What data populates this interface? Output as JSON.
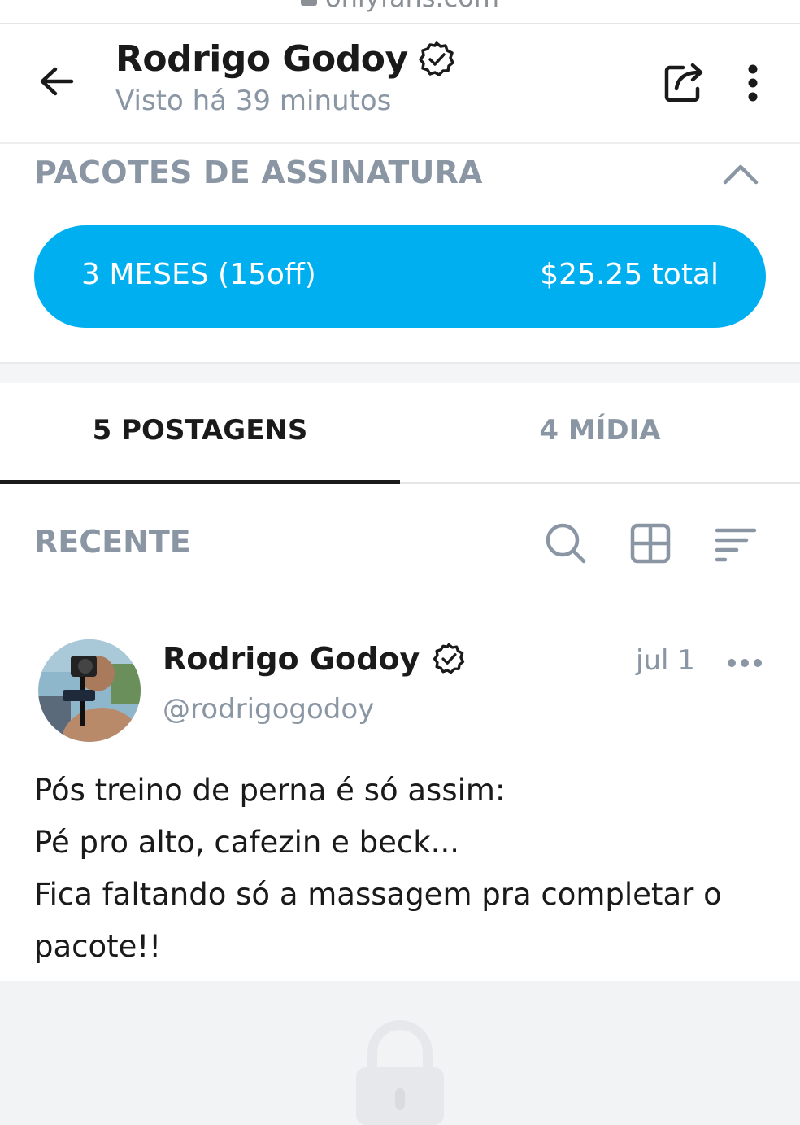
{
  "browser": {
    "url": "onlyfans.com"
  },
  "header": {
    "title": "Rodrigo Godoy",
    "last_seen": "Visto  há 39 minutos"
  },
  "subscription": {
    "section_title": "PACOTES DE ASSINATURA",
    "plan_label": "3 MESES (15off)",
    "plan_price": "$25.25 total"
  },
  "tabs": [
    {
      "label": "5 POSTAGENS",
      "active": true
    },
    {
      "label": "4 MÍDIA",
      "active": false
    }
  ],
  "feed": {
    "sort_label": "RECENTE"
  },
  "post": {
    "author": "Rodrigo Godoy",
    "handle": "@rodrigogodoy",
    "date": "jul 1",
    "text_lines": [
      "Pós treino de perna é só assim:",
      "Pé pro alto, cafezin e beck...",
      "Fica faltando só a massagem pra completar o",
      "pacote!!"
    ]
  },
  "colors": {
    "accent": "#00aff0",
    "muted_text": "#8a96a3",
    "primary_text": "#1a1a1a"
  },
  "icons": [
    "back-arrow-icon",
    "verified-badge-icon",
    "share-icon",
    "more-vertical-icon",
    "chevron-up-icon",
    "search-icon",
    "grid-icon",
    "sort-icon",
    "more-horizontal-icon",
    "lock-icon"
  ]
}
